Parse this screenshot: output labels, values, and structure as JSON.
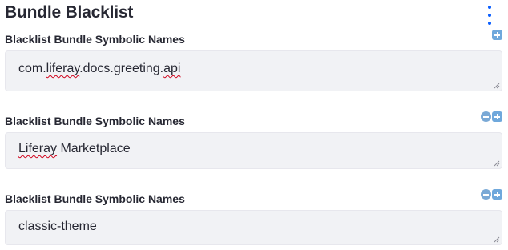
{
  "page": {
    "title": "Bundle Blacklist"
  },
  "fields": [
    {
      "label": "Blacklist Bundle Symbolic Names",
      "value_parts": [
        "com.",
        "liferay",
        ".docs.greeting.",
        "api"
      ],
      "show_remove": false
    },
    {
      "label": "Blacklist Bundle Symbolic Names",
      "value_parts": [
        "Liferay",
        " Marketplace"
      ],
      "show_remove": true
    },
    {
      "label": "Blacklist Bundle Symbolic Names",
      "value_parts": [
        "classic-theme"
      ],
      "show_remove": true
    }
  ],
  "icons": {
    "menu": "kebab-vertical-icon",
    "add": "plus-square-icon",
    "remove": "minus-circle-icon",
    "resize": "resize-grip-icon"
  },
  "colors": {
    "accent": "#0b5fff",
    "field_bg": "#f1f2f5",
    "control_blue": "#6fa8dc"
  }
}
